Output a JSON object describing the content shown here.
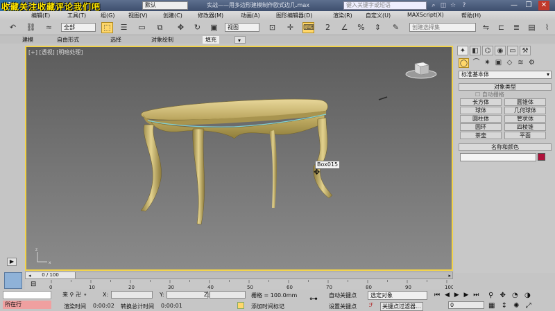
{
  "titlebar": {
    "overlay_text": "收藏关注收藏评论我们吧",
    "workspace_combo": "默认",
    "doc_title": "实战——用多边形建模制作欧式边几.max",
    "search_placeholder": "键入关键字或短语",
    "win_minimize": "—",
    "win_restore": "❐",
    "win_close": "✕"
  },
  "menu": [
    "编辑(E)",
    "工具(T)",
    "组(G)",
    "视图(V)",
    "创建(C)",
    "修改器(M)",
    "动画(A)",
    "图形编辑器(D)",
    "渲染(R)",
    "自定义(U)",
    "MAXScript(X)",
    "帮助(H)"
  ],
  "toolbar": {
    "filter_select": "全部",
    "refcoord_select": "视图",
    "selection_set": "创建选择集"
  },
  "ribbon_tabs": [
    "建模",
    "自由形式",
    "选择",
    "对象绘制",
    "填充"
  ],
  "viewport": {
    "label_plus": "[+]",
    "label_view": "[透视]",
    "label_shading": "[明暗处理]",
    "object_tooltip": "Box015"
  },
  "cmdpanel": {
    "category_select": "标准基本体",
    "object_type_header": "对象类型",
    "autogrid_label": "自动栅格",
    "object_buttons": [
      "长方体",
      "圆锥体",
      "球体",
      "几何球体",
      "圆柱体",
      "管状体",
      "圆环",
      "四棱锥",
      "茶壶",
      "平面"
    ],
    "name_color_header": "名称和颜色",
    "object_color": "#b0103a"
  },
  "timeline": {
    "frame_label": "0 / 100",
    "ruler_ticks": [
      "0",
      "10",
      "20",
      "30",
      "40",
      "50",
      "60",
      "70",
      "80",
      "90",
      "100"
    ]
  },
  "status": {
    "selected_label": "所在行",
    "render_time_label": "渲染时间",
    "render_time": "0:00:02",
    "translate_time_label": "转换总计时间",
    "translate_time": "0:00:01",
    "x_label": "X:",
    "y_label": "Y:",
    "z_label": "Z:",
    "grid_label": "栅格 = 100.0mm",
    "add_timetag": "添加时间标记",
    "auto_key": "自动关键点",
    "set_key": "设置关键点",
    "selected_object": "选定对象",
    "key_filter": "关键点过滤器...",
    "current_frame": "0"
  },
  "colors": {
    "viewport_border": "#f2d34a",
    "active_highlight": "#ffd76a"
  }
}
